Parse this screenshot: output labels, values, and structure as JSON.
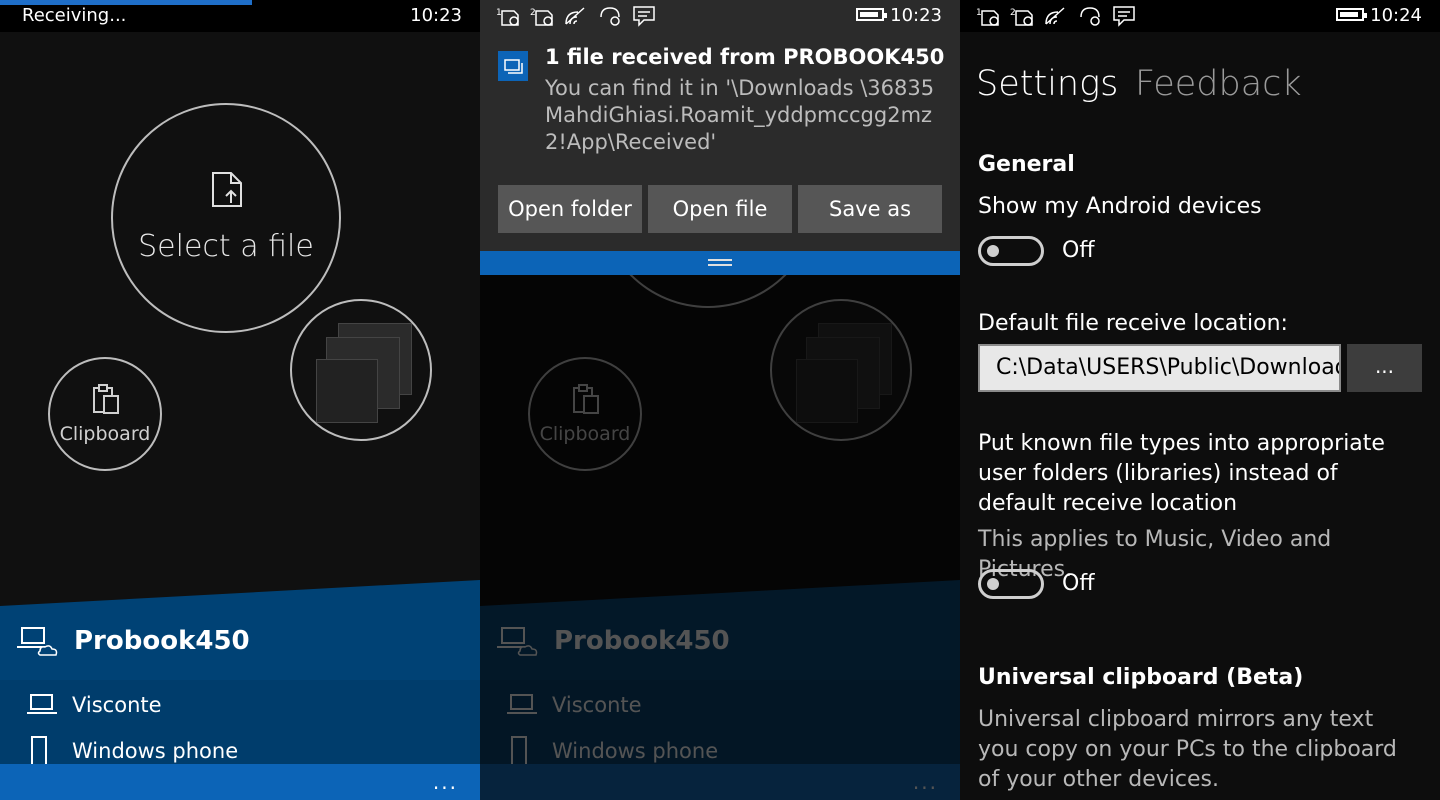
{
  "panel1": {
    "status": {
      "receiving": "Receiving...",
      "time": "10:23"
    },
    "select_file": "Select a file",
    "clipboard": "Clipboard",
    "device_main": "Probook450",
    "devices": [
      "Visconte",
      "Windows phone"
    ],
    "progress": 0.525,
    "more": "..."
  },
  "panel2": {
    "status": {
      "time": "10:23"
    },
    "notification": {
      "title": "1 file received from PROBOOK450",
      "body": "You can find it in '\\Downloads \\36835MahdiGhiasi.Roamit_yddpmccgg2mz2!App\\Received'",
      "buttons": [
        "Open folder",
        "Open file",
        "Save as"
      ]
    },
    "clipboard": "Clipboard",
    "device_main": "Probook450",
    "devices": [
      "Visconte",
      "Windows phone"
    ],
    "more": "..."
  },
  "panel3": {
    "status": {
      "time": "10:24"
    },
    "tabs": [
      "Settings",
      "Feedback"
    ],
    "general_header": "General",
    "android_label": "Show my Android devices",
    "android_toggle": "Off",
    "location_label": "Default file receive location:",
    "location_value": "C:\\Data\\USERS\\Public\\Downloads",
    "browse_label": "...",
    "known_types_label": "Put known file types into appropriate user folders (libraries) instead of default receive location",
    "known_types_note": "This applies to Music, Video and Pictures.",
    "known_types_toggle": "Off",
    "clipboard_header": "Universal clipboard (Beta)",
    "clipboard_desc": "Universal clipboard mirrors any text you copy on your PCs to the clipboard of your other devices."
  },
  "colors": {
    "accent": "#0c64b7",
    "device_panel": "#004275"
  },
  "icons": [
    "file-upload-icon",
    "clipboard-icon",
    "laptop-cloud-icon",
    "laptop-icon",
    "phone-icon",
    "signal-icon",
    "wifi-icon",
    "message-icon",
    "battery-icon",
    "notification-app-icon"
  ]
}
